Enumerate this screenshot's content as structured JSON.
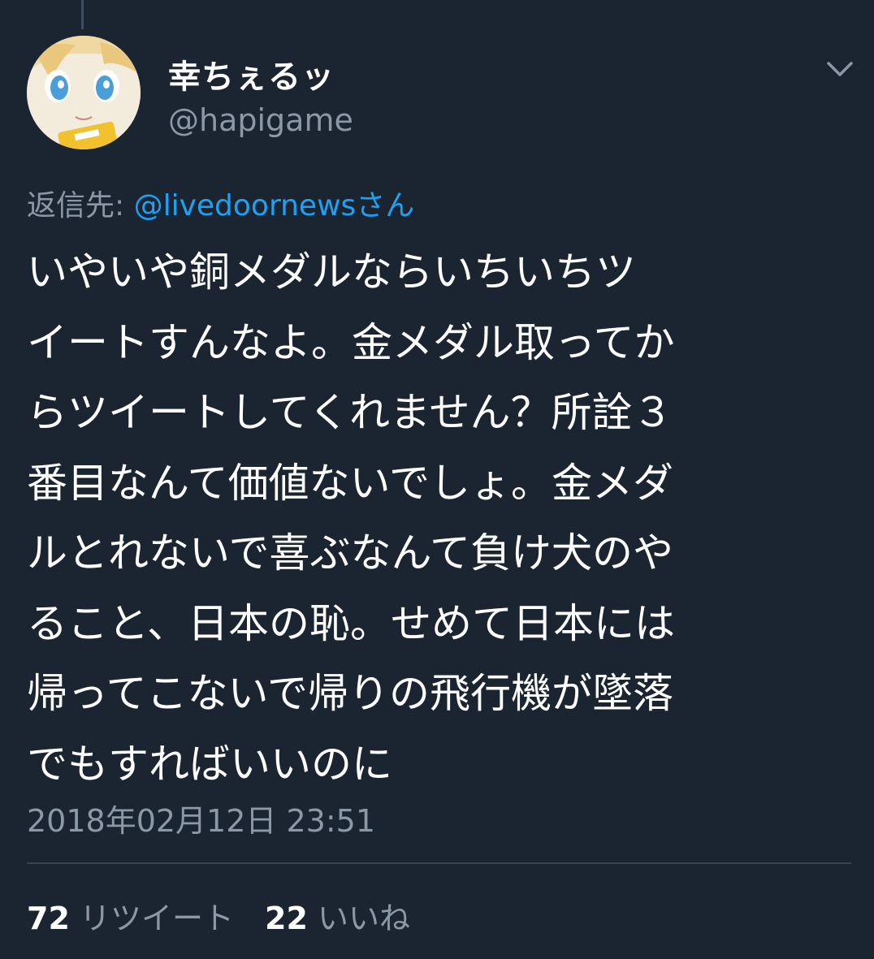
{
  "author": {
    "display_name": "幸ちぇるッ",
    "handle": "@hapigame"
  },
  "reply": {
    "prefix": "返信先: ",
    "mention": "@livedoornewsさん"
  },
  "tweet": {
    "lines": [
      "いやいや銅メダルならいちいちツ",
      "イートすんなよ。金メダル取ってか",
      "らツイートしてくれません？所詮３",
      "番目なんて価値ないでしょ。金メダ",
      "ルとれないで喜ぶなんて負け犬のや",
      "ること、日本の恥。せめて日本には",
      "帰ってこないで帰りの飛行機が墜落",
      "でもすればいいのに"
    ]
  },
  "timestamp": "2018年02月12日 23:51",
  "stats": {
    "retweets_count": "72",
    "retweets_label": "リツイート",
    "likes_count": "22",
    "likes_label": "いいね"
  },
  "icons": {
    "menu": "chevron-down-icon"
  },
  "colors": {
    "background": "#1b2532",
    "text": "#ffffff",
    "secondary": "#8b98a5",
    "link": "#1da1f2",
    "divider": "#38444d"
  }
}
